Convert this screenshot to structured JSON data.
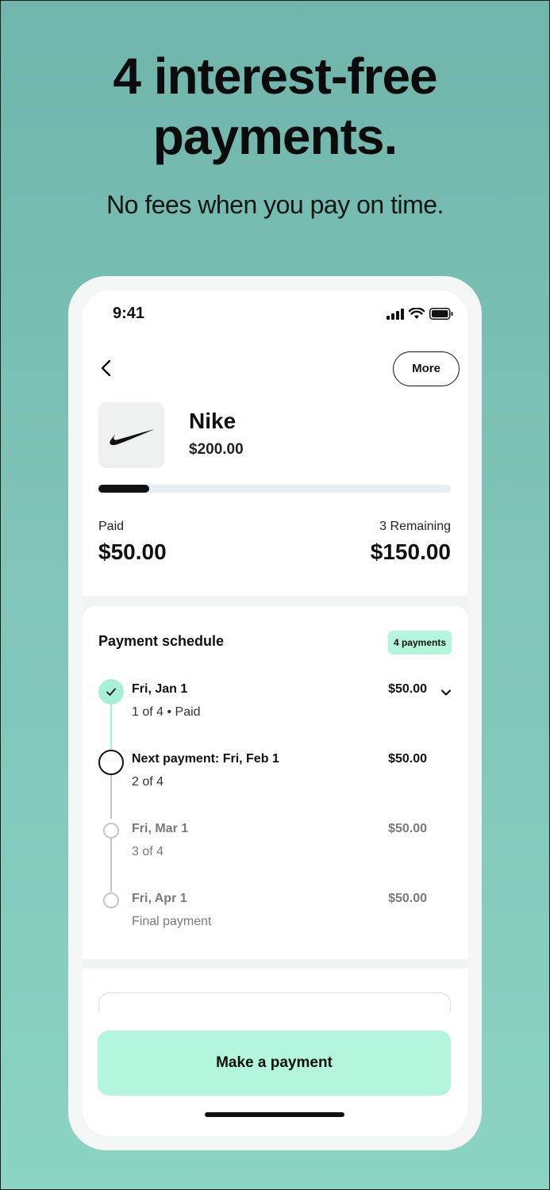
{
  "promo": {
    "headline_line1": "4 interest-free",
    "headline_line2": "payments.",
    "subheadline": "No fees when you pay on time."
  },
  "status_bar": {
    "time": "9:41",
    "icons": [
      "cellular-signal-icon",
      "wifi-icon",
      "battery-icon"
    ]
  },
  "header": {
    "back_icon": "chevron-left-icon",
    "more_label": "More"
  },
  "merchant": {
    "logo": "nike-swoosh-icon",
    "name": "Nike",
    "total": "$200.00"
  },
  "progress": {
    "paid_fraction": 0.25
  },
  "summary": {
    "paid_label": "Paid",
    "paid_amount": "$50.00",
    "remaining_label": "3 Remaining",
    "remaining_amount": "$150.00"
  },
  "schedule": {
    "title": "Payment schedule",
    "badge": "4 payments",
    "payments": [
      {
        "title": "Fri, Jan 1",
        "subtitle": "1 of 4 • Paid",
        "amount": "$50.00",
        "status": "paid"
      },
      {
        "title": "Next payment: Fri, Feb 1",
        "subtitle": "2 of 4",
        "amount": "$50.00",
        "status": "next"
      },
      {
        "title": "Fri, Mar 1",
        "subtitle": "3 of 4",
        "amount": "$50.00",
        "status": "upcoming"
      },
      {
        "title": "Fri, Apr 1",
        "subtitle": "Final payment",
        "amount": "$50.00",
        "status": "upcoming"
      }
    ]
  },
  "actions": {
    "make_payment_label": "Make a payment"
  },
  "colors": {
    "accent": "#b4f5de",
    "paid_dot": "#a6f0d6",
    "background_top": "#6fb5ab",
    "background_bottom": "#8bd3c3"
  }
}
